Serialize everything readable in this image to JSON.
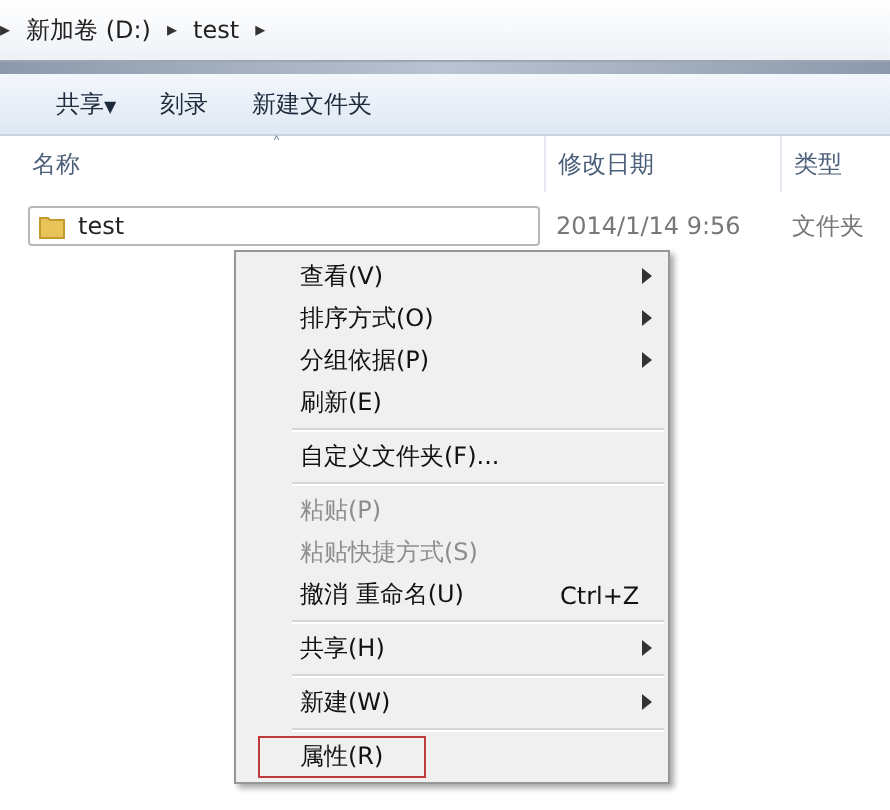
{
  "address_bar": {
    "arrow": "▸",
    "crumbs": [
      {
        "label": "新加卷 (D:)",
        "arrow": "▸"
      },
      {
        "label": "test",
        "arrow": "▸"
      }
    ]
  },
  "toolbar": {
    "buttons": [
      {
        "label": "共享",
        "dropdown": "▼"
      },
      {
        "label": "刻录"
      },
      {
        "label": "新建文件夹"
      }
    ]
  },
  "columns": [
    {
      "label": "名称",
      "sort": "˄"
    },
    {
      "label": "修改日期"
    },
    {
      "label": "类型"
    }
  ],
  "rows": [
    {
      "name": "test",
      "date": "2014/1/14 9:56",
      "type": "文件夹",
      "selected": true
    }
  ],
  "context_menu": [
    {
      "kind": "item",
      "label": "查看(V)",
      "submenu": true,
      "disabled": false
    },
    {
      "kind": "item",
      "label": "排序方式(O)",
      "submenu": true,
      "disabled": false
    },
    {
      "kind": "item",
      "label": "分组依据(P)",
      "submenu": true,
      "disabled": false
    },
    {
      "kind": "item",
      "label": "刷新(E)",
      "submenu": false,
      "disabled": false
    },
    {
      "kind": "separator"
    },
    {
      "kind": "item",
      "label": "自定义文件夹(F)...",
      "submenu": false,
      "disabled": false
    },
    {
      "kind": "separator"
    },
    {
      "kind": "item",
      "label": "粘贴(P)",
      "submenu": false,
      "disabled": true
    },
    {
      "kind": "item",
      "label": "粘贴快捷方式(S)",
      "submenu": false,
      "disabled": true
    },
    {
      "kind": "item",
      "label": "撤消 重命名(U)",
      "shortcut": "Ctrl+Z",
      "submenu": false,
      "disabled": false
    },
    {
      "kind": "separator"
    },
    {
      "kind": "item",
      "label": "共享(H)",
      "submenu": true,
      "disabled": false
    },
    {
      "kind": "separator"
    },
    {
      "kind": "item",
      "label": "新建(W)",
      "submenu": true,
      "disabled": false
    },
    {
      "kind": "separator"
    },
    {
      "kind": "item",
      "label": "属性(R)",
      "submenu": false,
      "disabled": false,
      "outlined": true
    }
  ]
}
